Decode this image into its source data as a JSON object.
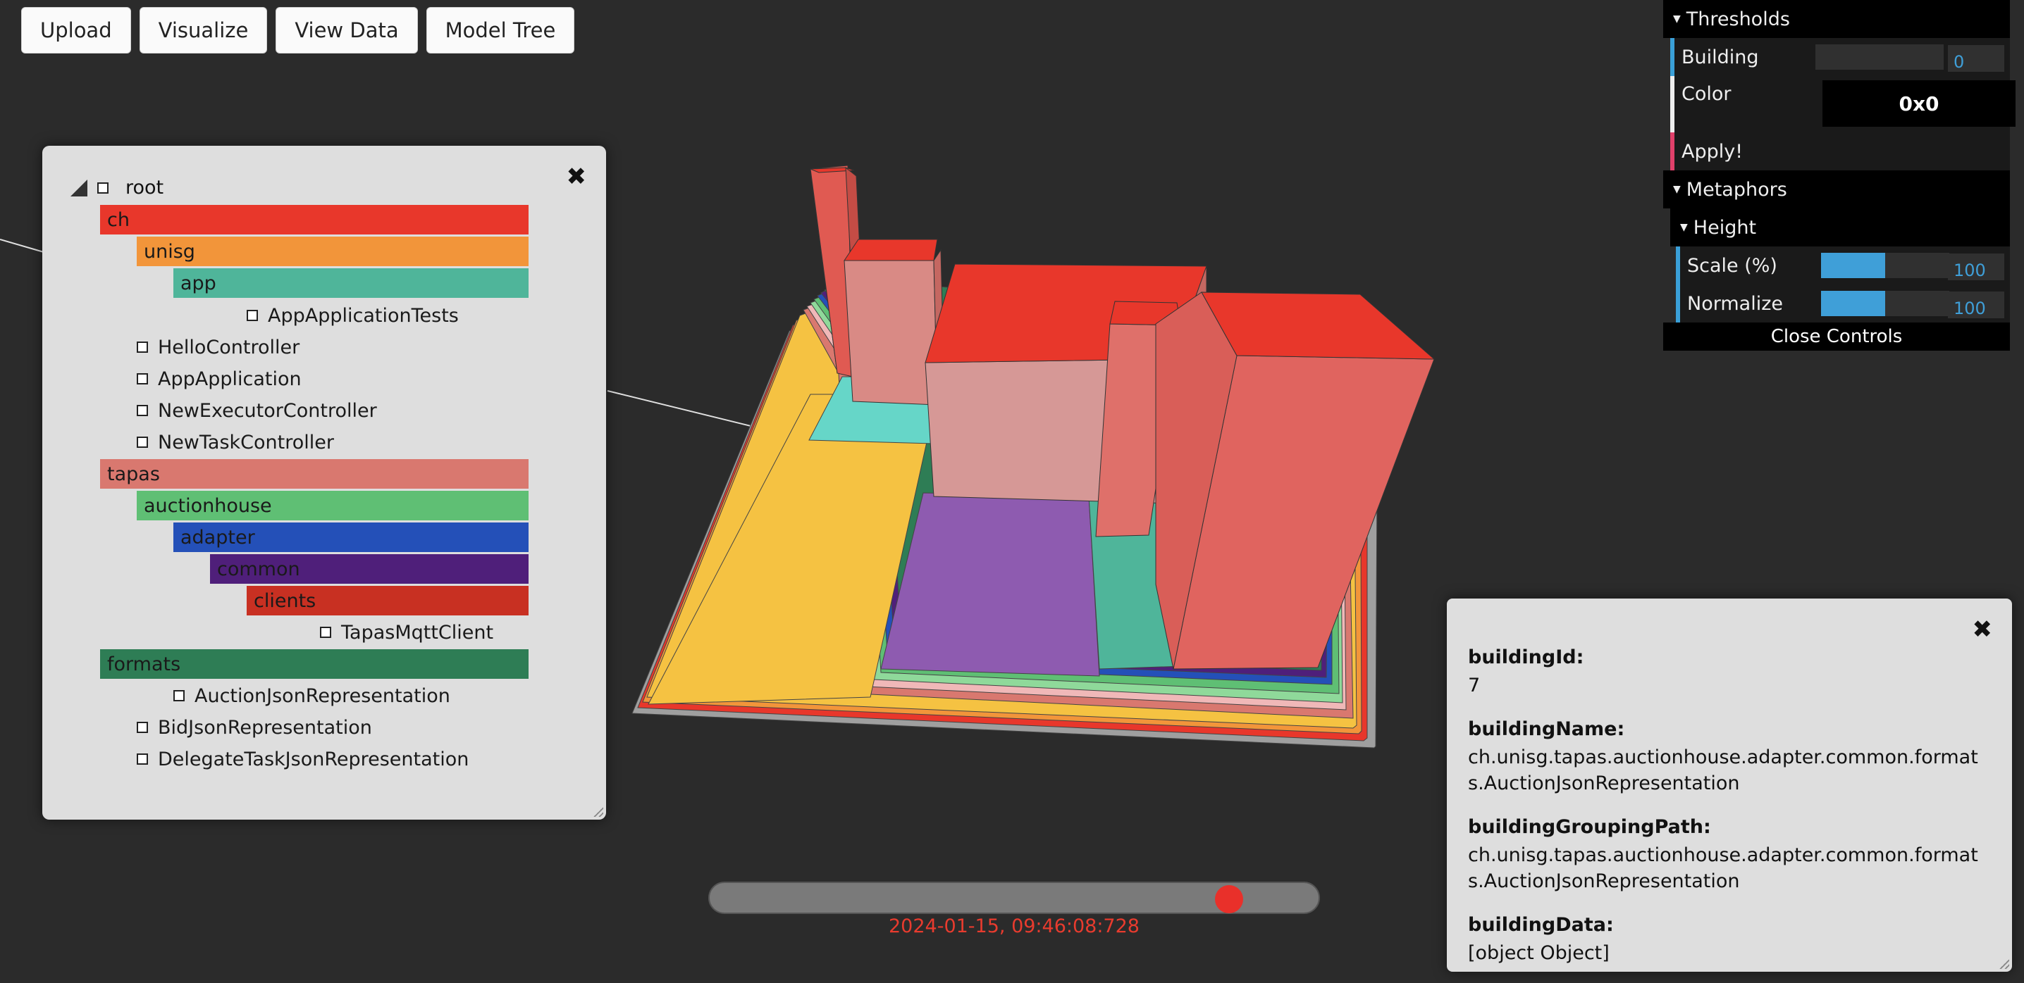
{
  "toolbar": {
    "buttons": [
      "Upload",
      "Visualize",
      "View Data",
      "Model Tree"
    ]
  },
  "tree": {
    "root_label": "root",
    "packages": [
      {
        "label": "ch",
        "color": "#e8372b"
      },
      {
        "label": "unisg",
        "color": "#f2953a"
      },
      {
        "label": "app",
        "color": "#4fb59a"
      },
      {
        "label": "tapas",
        "color": "#d9786f"
      },
      {
        "label": "auctionhouse",
        "color": "#5fbf74"
      },
      {
        "label": "adapter",
        "color": "#2450b8"
      },
      {
        "label": "common",
        "color": "#4f1f7a"
      },
      {
        "label": "clients",
        "color": "#c83022"
      },
      {
        "label": "formats",
        "color": "#2e7d55"
      }
    ],
    "leaves": [
      "AppApplicationTests",
      "HelloController",
      "AppApplication",
      "NewExecutorController",
      "NewTaskController",
      "TapasMqttClient",
      "AuctionJsonRepresentation",
      "BidJsonRepresentation",
      "DelegateTaskJsonRepresentation"
    ]
  },
  "controls": {
    "thresholds_label": "Thresholds",
    "building_label": "Building",
    "building_value": "0",
    "color_label": "Color",
    "color_value": "0x0",
    "apply_label": "Apply!",
    "metaphors_label": "Metaphors",
    "height_label": "Height",
    "scale_label": "Scale (%)",
    "scale_value": "100",
    "normalize_label": "Normalize",
    "normalize_value": "100",
    "close_label": "Close Controls",
    "accent_color": "#3f9fd8"
  },
  "info": {
    "id_key": "buildingId:",
    "id_value": "7",
    "name_key": "buildingName:",
    "name_value": "ch.unisg.tapas.auctionhouse.adapter.common.formats.AuctionJsonRepresentation",
    "path_key": "buildingGroupingPath:",
    "path_value": "ch.unisg.tapas.auctionhouse.adapter.common.formats.AuctionJsonRepresentation",
    "data_key": "buildingData:",
    "data_value": "[object Object]"
  },
  "timeline": {
    "position_fraction": 0.87,
    "timestamp": "2024-01-15, 09:46:08:728"
  }
}
